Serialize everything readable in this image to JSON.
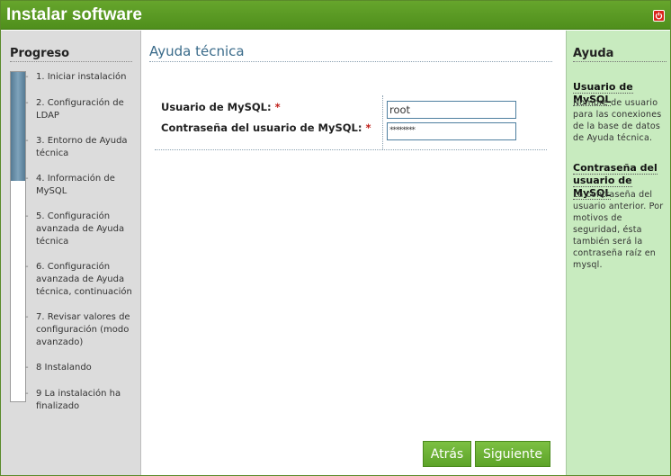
{
  "window": {
    "title": "Instalar software",
    "close_icon": "power-icon"
  },
  "progress": {
    "heading": "Progreso",
    "filled_fraction": 0.33,
    "steps": [
      "1. Iniciar instalación",
      "2. Configuración de LDAP",
      "3. Entorno de Ayuda técnica",
      "4. Información de MySQL",
      "5. Configuración avanzada de Ayuda técnica",
      "6. Configuración avanzada de Ayuda técnica, continuación",
      "7. Revisar valores de configuración (modo avanzado)",
      "8 Instalando",
      "9 La instalación ha finalizado"
    ]
  },
  "main": {
    "title": "Ayuda técnica",
    "fields": [
      {
        "label": "Usuario de MySQL:",
        "required_mark": "*",
        "value": "root"
      },
      {
        "label": "Contraseña del usuario de MySQL:",
        "required_mark": "*",
        "value": "********"
      }
    ],
    "back_label": "Atrás",
    "next_label": "Siguiente"
  },
  "help": {
    "heading": "Ayuda",
    "items": [
      {
        "title": "Usuario de MySQL",
        "text": "Nombre de usuario para las conexiones de la base de datos de Ayuda técnica."
      },
      {
        "title": "Contraseña del usuario de MySQL",
        "text": "La contraseña del usuario anterior. Por motivos de seguridad, ésta también será la contraseña raíz en mysql."
      }
    ]
  },
  "colors": {
    "titlebar": "#5a9a24",
    "accent_blue": "#3a6b8a",
    "help_bg": "#c8ebbf",
    "button": "#6cb135"
  }
}
